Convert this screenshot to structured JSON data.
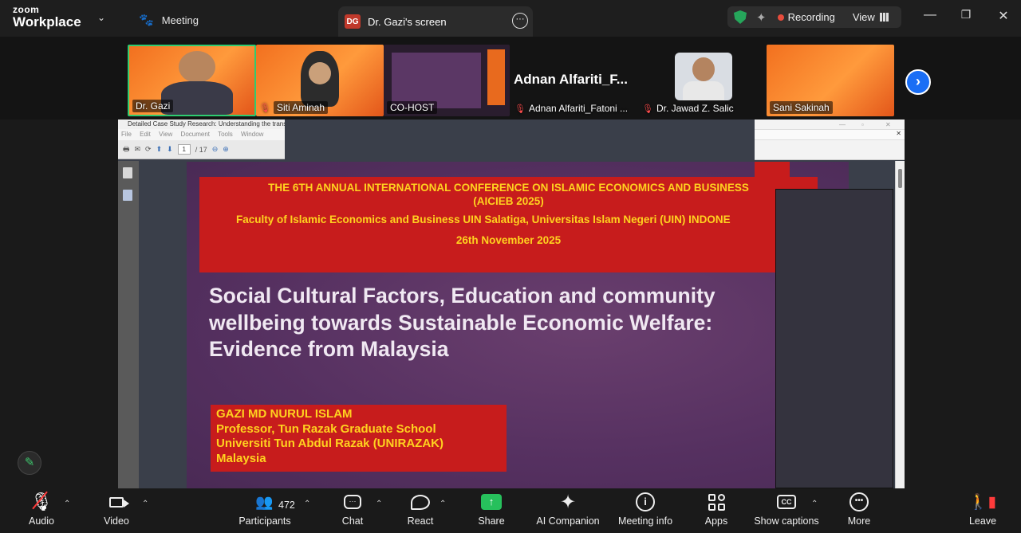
{
  "app": {
    "logo_top": "zoom",
    "logo_bottom": "Workplace"
  },
  "tabs": {
    "meeting": "Meeting",
    "screen_badge": "DG",
    "screen": "Dr. Gazi's screen"
  },
  "status": {
    "recording": "Recording",
    "view": "View"
  },
  "participants": [
    {
      "name": "Dr. Gazi",
      "muted": false
    },
    {
      "name": "Siti Aminah",
      "muted": true
    },
    {
      "name": "CO-HOST",
      "muted": false
    },
    {
      "name": "Adnan Alfariti_Fatoni ...",
      "muted": true,
      "big_label": "Adnan  Alfariti_F..."
    },
    {
      "name": "Dr. Jawad Z. Salic",
      "muted": true
    },
    {
      "name": "Sani Sakinah",
      "muted": false
    }
  ],
  "pdf": {
    "title": "Detailed Case Study Research: Understanding the transiti",
    "menu": "File Edit View Document Tools Window Help",
    "page_current": "1",
    "page_total": "/ 17"
  },
  "slide": {
    "banner_lines": [
      "THE 6TH ANNUAL INTERNATIONAL CONFERENCE ON ISLAMIC ECONOMICS AND BUSINESS",
      "(AICIEB 2025)",
      "Faculty of Islamic Economics and Business UIN Salatiga, Universitas Islam Negeri (UIN) INDONE",
      "26th November 2025"
    ],
    "title_lines": [
      "Social Cultural Factors, Education and community",
      "wellbeing towards Sustainable Economic Welfare:",
      "Evidence from Malaysia"
    ],
    "author_lines": [
      "GAZI MD NURUL ISLAM",
      "Professor, Tun Razak Graduate School",
      "Universiti Tun Abdul Razak (UNIRAZAK)",
      "Malaysia"
    ]
  },
  "toolbar": {
    "audio": "Audio",
    "video": "Video",
    "participants": "Participants",
    "participant_count": "472",
    "chat": "Chat",
    "react": "React",
    "share": "Share",
    "ai_companion": "AI Companion",
    "meeting_info": "Meeting info",
    "apps": "Apps",
    "captions": "Show captions",
    "more": "More",
    "leave": "Leave"
  },
  "colors": {
    "accent_green": "#27c05c",
    "banner_red": "#c71c1c",
    "banner_text": "#ffd21f",
    "next_blue": "#1a6ef5"
  }
}
